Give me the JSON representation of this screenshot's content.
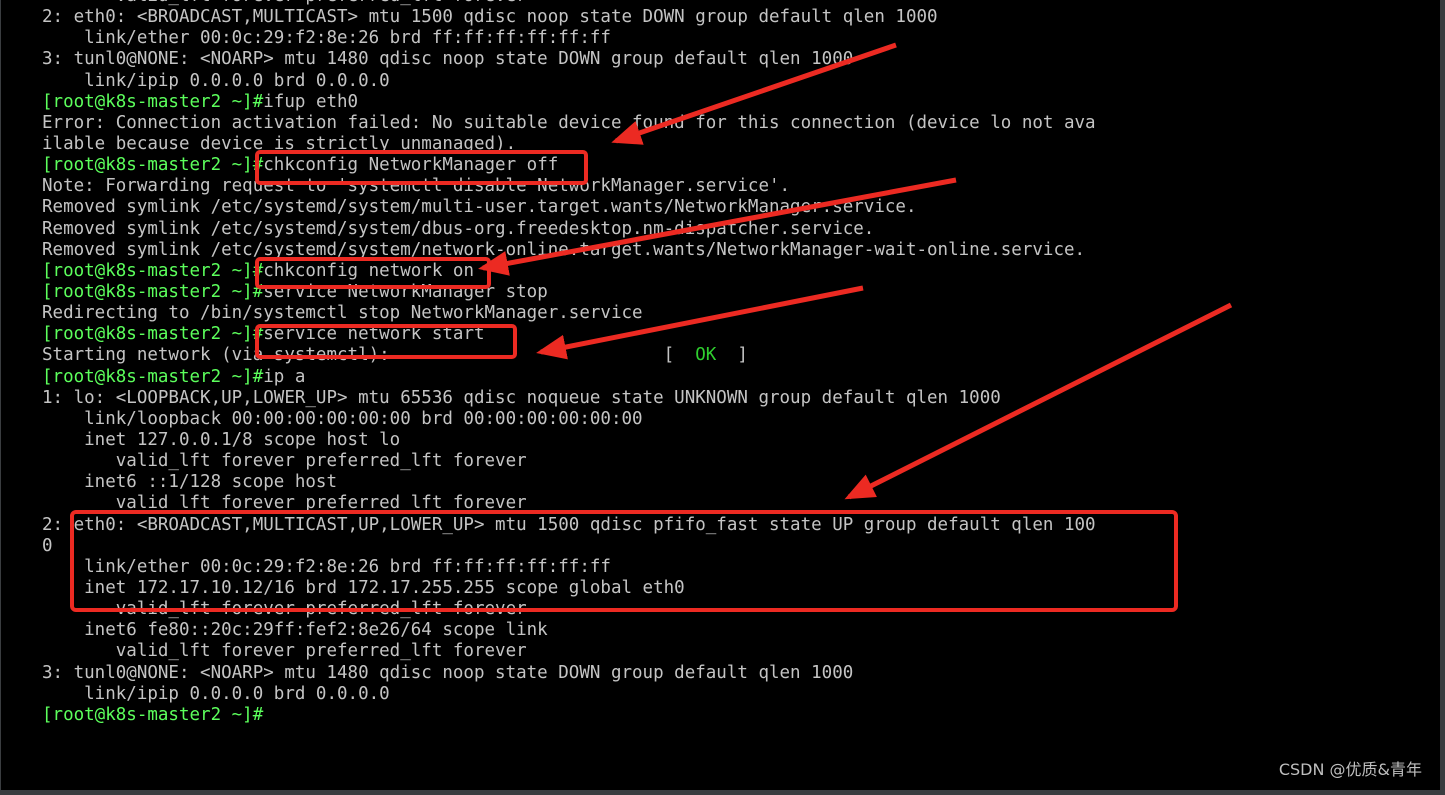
{
  "terminal": {
    "prompt": "[root@k8s-master2 ~]#",
    "lines": [
      {
        "text": "       valid_lft forever preferred_lft forever"
      },
      {
        "text": "2: eth0: <BROADCAST,MULTICAST> mtu 1500 qdisc noop state DOWN group default qlen 1000"
      },
      {
        "text": "    link/ether 00:0c:29:f2:8e:26 brd ff:ff:ff:ff:ff:ff"
      },
      {
        "text": "3: tunl0@NONE: <NOARP> mtu 1480 qdisc noop state DOWN group default qlen 1000"
      },
      {
        "text": "    link/ipip 0.0.0.0 brd 0.0.0.0"
      },
      {
        "prompt": true,
        "text": "ifup eth0"
      },
      {
        "text": "Error: Connection activation failed: No suitable device found for this connection (device lo not ava"
      },
      {
        "text": "ilable because device is strictly unmanaged)."
      },
      {
        "prompt": true,
        "text": "chkconfig NetworkManager off"
      },
      {
        "text": "Note: Forwarding request to 'systemctl disable NetworkManager.service'."
      },
      {
        "text": "Removed symlink /etc/systemd/system/multi-user.target.wants/NetworkManager.service."
      },
      {
        "text": "Removed symlink /etc/systemd/system/dbus-org.freedesktop.nm-dispatcher.service."
      },
      {
        "text": "Removed symlink /etc/systemd/system/network-online.target.wants/NetworkManager-wait-online.service."
      },
      {
        "prompt": true,
        "text": "chkconfig network on"
      },
      {
        "prompt": true,
        "text": "service NetworkManager stop"
      },
      {
        "text": "Redirecting to /bin/systemctl stop NetworkManager.service"
      },
      {
        "prompt": true,
        "text": "service network start"
      },
      {
        "text": "Starting network (via systemctl):                          ",
        "status_open": "[  ",
        "status": "OK",
        "status_close": "  ]"
      },
      {
        "prompt": true,
        "text": "ip a"
      },
      {
        "text": "1: lo: <LOOPBACK,UP,LOWER_UP> mtu 65536 qdisc noqueue state UNKNOWN group default qlen 1000"
      },
      {
        "text": "    link/loopback 00:00:00:00:00:00 brd 00:00:00:00:00:00"
      },
      {
        "text": "    inet 127.0.0.1/8 scope host lo"
      },
      {
        "text": "       valid_lft forever preferred_lft forever"
      },
      {
        "text": "    inet6 ::1/128 scope host"
      },
      {
        "text": "       valid_lft forever preferred_lft forever"
      },
      {
        "text": "2: eth0: <BROADCAST,MULTICAST,UP,LOWER_UP> mtu 1500 qdisc pfifo_fast state UP group default qlen 100"
      },
      {
        "text": "0"
      },
      {
        "text": "    link/ether 00:0c:29:f2:8e:26 brd ff:ff:ff:ff:ff:ff"
      },
      {
        "text": "    inet 172.17.10.12/16 brd 172.17.255.255 scope global eth0"
      },
      {
        "text": "       valid_lft forever preferred_lft forever"
      },
      {
        "text": "    inet6 fe80::20c:29ff:fef2:8e26/64 scope link"
      },
      {
        "text": "       valid_lft forever preferred_lft forever"
      },
      {
        "text": "3: tunl0@NONE: <NOARP> mtu 1480 qdisc noop state DOWN group default qlen 1000"
      },
      {
        "text": "    link/ipip 0.0.0.0 brd 0.0.0.0"
      },
      {
        "prompt": true,
        "text": ""
      }
    ]
  },
  "annotation_color": "#ec2a22",
  "watermark": "CSDN @优质&青年"
}
